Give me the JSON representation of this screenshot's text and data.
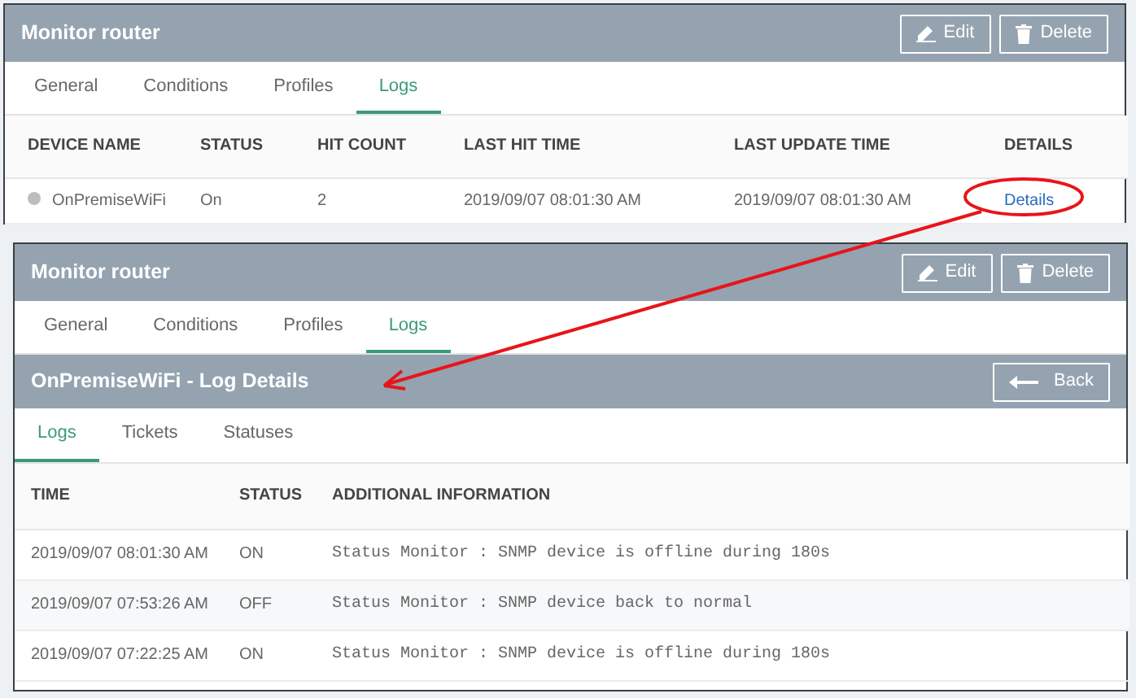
{
  "panels": [
    {
      "title": "Monitor router",
      "buttons": [
        {
          "kind": "edit",
          "label": "Edit"
        },
        {
          "kind": "delete",
          "label": "Delete"
        }
      ],
      "tabs": [
        {
          "label": "General",
          "selected": false
        },
        {
          "label": "Conditions",
          "selected": false
        },
        {
          "label": "Profiles",
          "selected": false
        },
        {
          "label": "Logs",
          "selected": true
        }
      ],
      "table": {
        "columns": [
          "DEVICE NAME",
          "STATUS",
          "HIT COUNT",
          "LAST HIT TIME",
          "LAST UPDATE TIME",
          "DETAILS"
        ],
        "rows": [
          [
            {
              "kind": "device",
              "text": "OnPremiseWiFi"
            },
            {
              "kind": "text",
              "text": "On"
            },
            {
              "kind": "text",
              "text": "2"
            },
            {
              "kind": "text",
              "text": "2019/09/07 08:01:30 AM"
            },
            {
              "kind": "text",
              "text": "2019/09/07 08:01:30 AM"
            },
            {
              "kind": "link",
              "text": "Details"
            }
          ]
        ]
      }
    },
    {
      "title": "Monitor router",
      "buttons": [
        {
          "kind": "edit",
          "label": "Edit"
        },
        {
          "kind": "delete",
          "label": "Delete"
        }
      ],
      "tabs": [
        {
          "label": "General",
          "selected": false
        },
        {
          "label": "Conditions",
          "selected": false
        },
        {
          "label": "Profiles",
          "selected": false
        },
        {
          "label": "Logs",
          "selected": true
        }
      ],
      "detail": {
        "title": "OnPremiseWiFi - Log Details",
        "back_button": "Back",
        "tabs": [
          {
            "label": "Logs",
            "selected": true
          },
          {
            "label": "Tickets",
            "selected": false
          },
          {
            "label": "Statuses",
            "selected": false
          }
        ],
        "table": {
          "columns": [
            "TIME",
            "STATUS",
            "ADDITIONAL INFORMATION"
          ],
          "rows": [
            [
              {
                "kind": "text",
                "text": "2019/09/07 08:01:30 AM"
              },
              {
                "kind": "text",
                "text": "ON"
              },
              {
                "kind": "mono",
                "text": "Status Monitor : SNMP device is offline during 180s"
              }
            ],
            [
              {
                "kind": "text",
                "text": "2019/09/07 07:53:26 AM"
              },
              {
                "kind": "text",
                "text": "OFF"
              },
              {
                "kind": "mono",
                "text": "Status Monitor : SNMP device back to normal"
              }
            ],
            [
              {
                "kind": "text",
                "text": "2019/09/07 07:22:25 AM"
              },
              {
                "kind": "text",
                "text": "ON"
              },
              {
                "kind": "mono",
                "text": "Status Monitor : SNMP device is offline during 180s"
              }
            ]
          ]
        }
      }
    }
  ]
}
